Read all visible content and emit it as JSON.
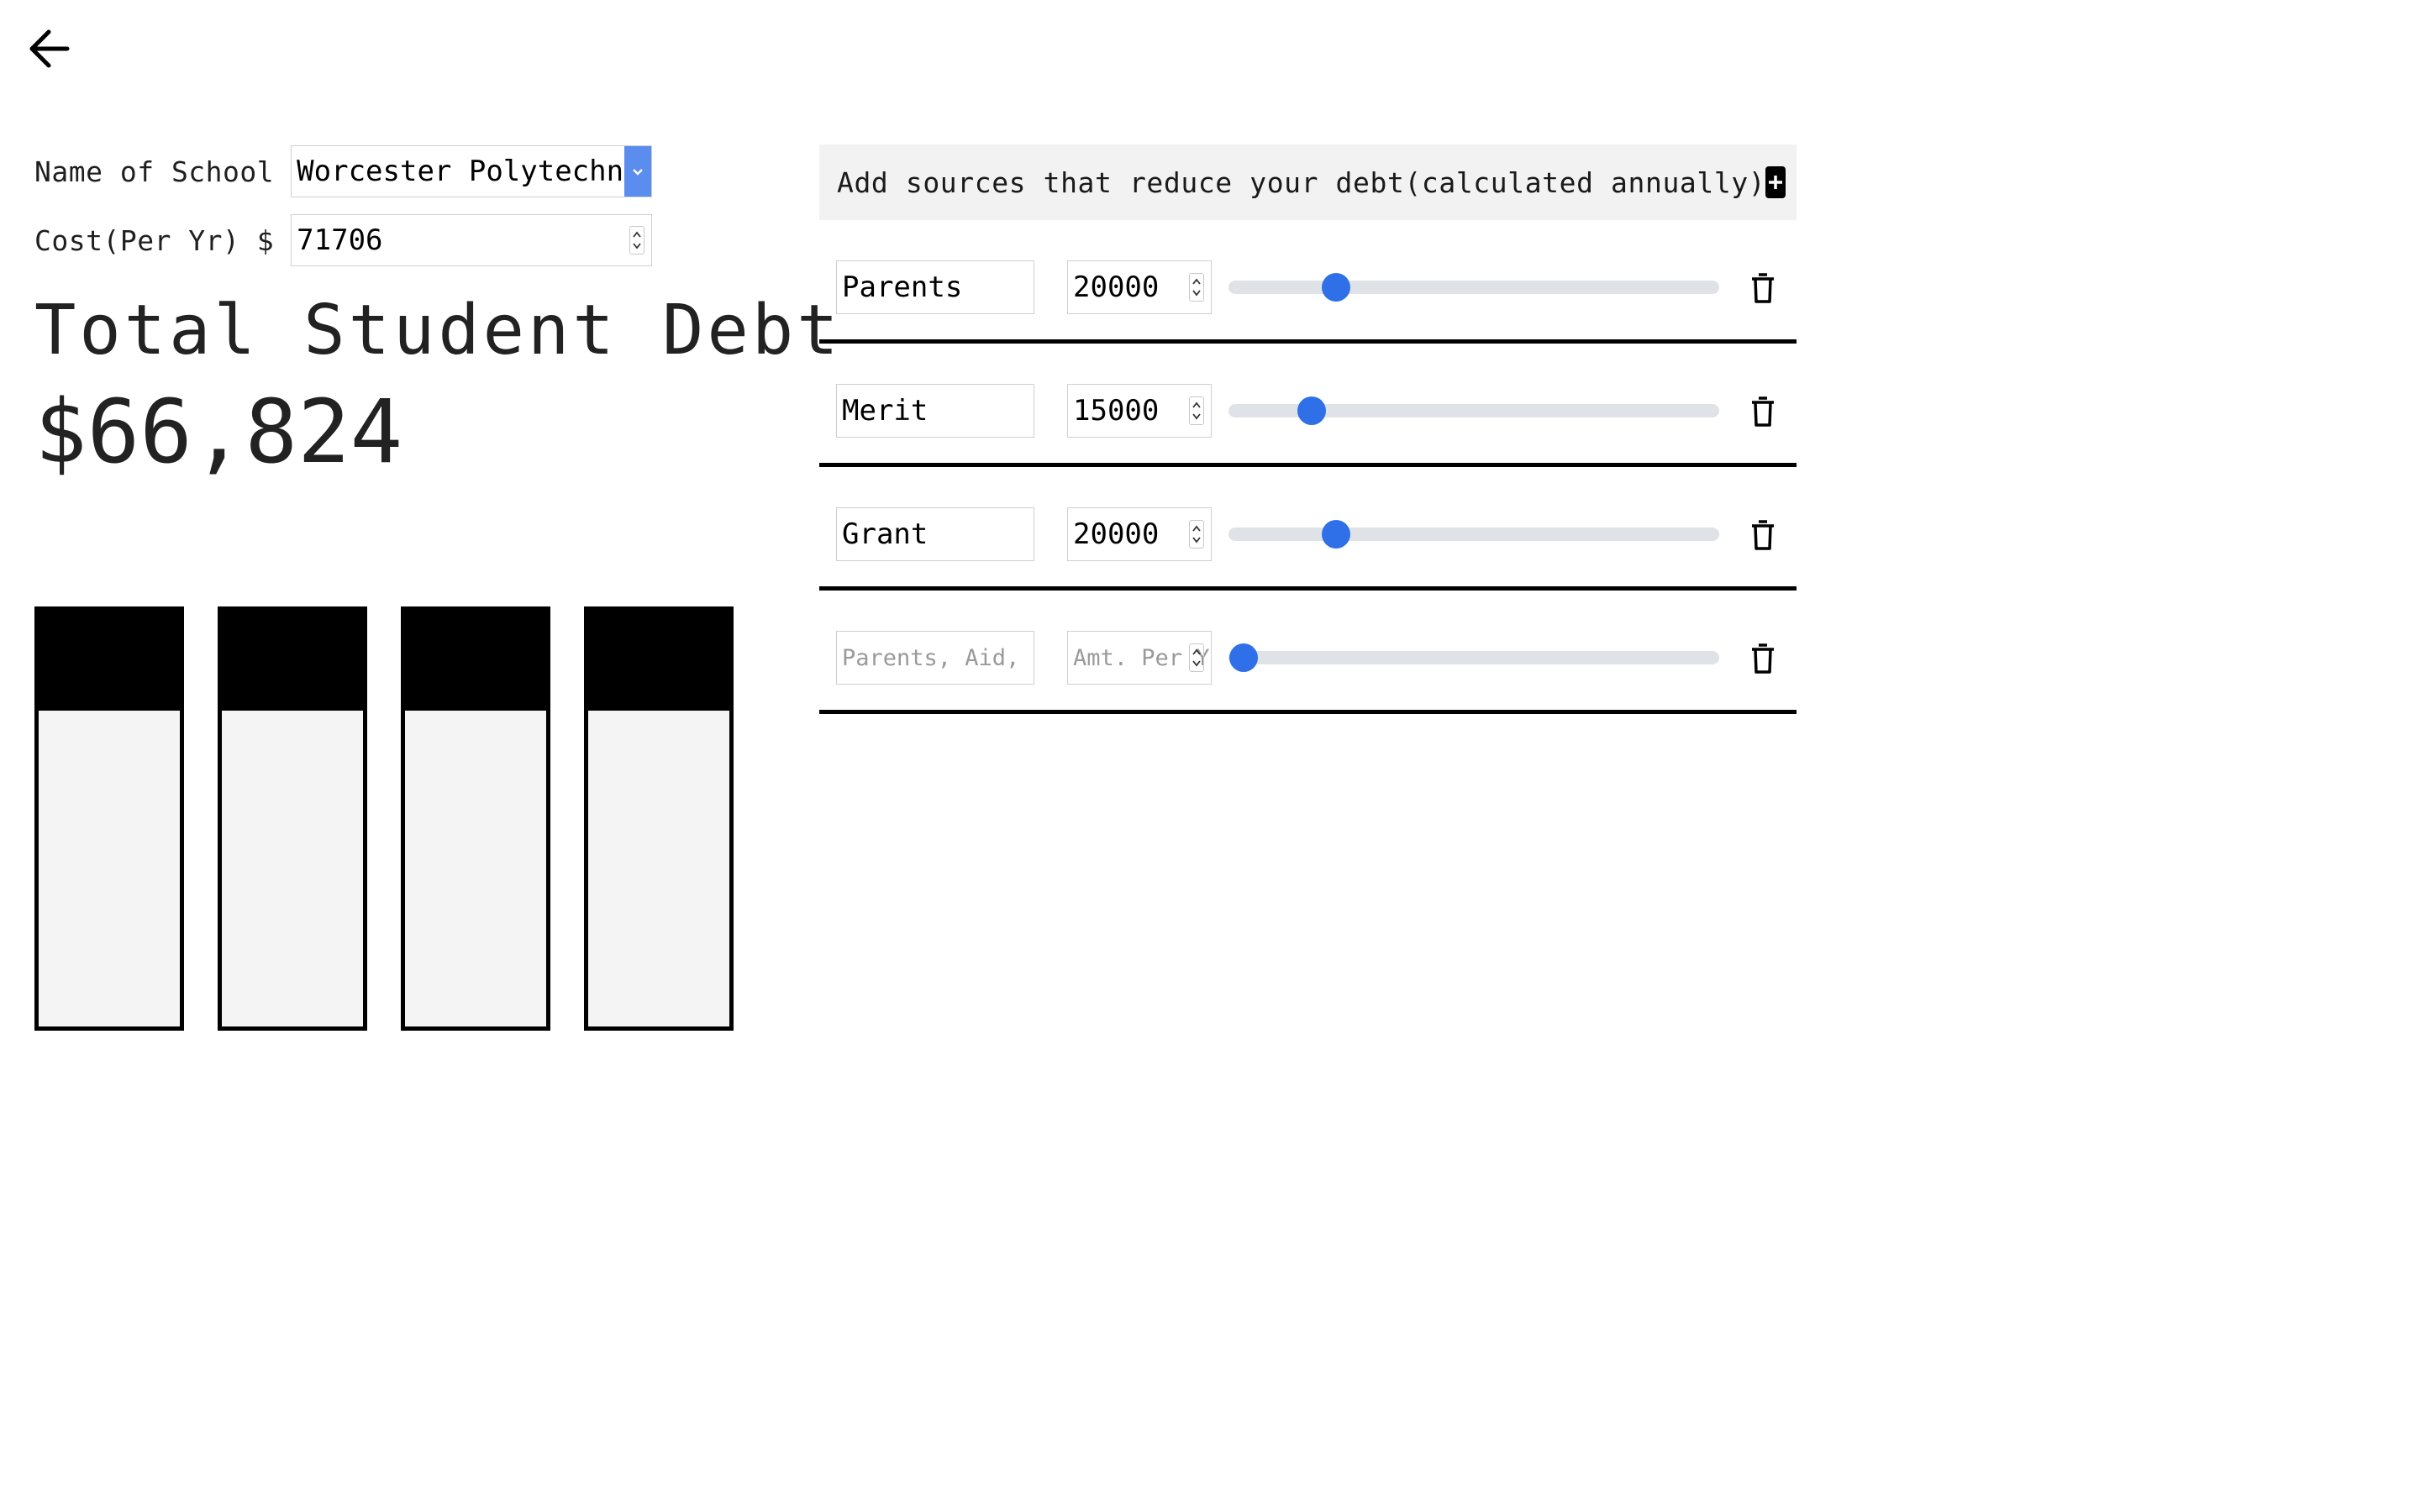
{
  "nav": {
    "back_icon": "arrow-left-icon"
  },
  "school": {
    "name_label": "Name of School",
    "name_value": "Worcester Polytechnic Institute",
    "cost_label": "Cost(Per Yr) $",
    "cost_value": "71706"
  },
  "summary": {
    "title": "Total Student Debt",
    "amount": "$66,824"
  },
  "bars": [
    {
      "fill_fraction": 0.24
    },
    {
      "fill_fraction": 0.24
    },
    {
      "fill_fraction": 0.24
    },
    {
      "fill_fraction": 0.24
    }
  ],
  "sources": {
    "header_text": "Add sources that reduce your debt(calculated annually)",
    "add_icon": "plus-square-icon",
    "rows": [
      {
        "name": "Parents",
        "amount": "20000",
        "slider_fraction": 0.22
      },
      {
        "name": "Merit",
        "amount": "15000",
        "slider_fraction": 0.17
      },
      {
        "name": "Grant",
        "amount": "20000",
        "slider_fraction": 0.22
      },
      {
        "name": "",
        "amount": "",
        "name_placeholder": "Parents, Aid, ...",
        "amount_placeholder": "Amt. Per Yr",
        "slider_fraction": 0.03
      }
    ],
    "delete_icon": "trash-icon"
  },
  "colors": {
    "accent": "#2f6fe8",
    "slider_track": "#dfe2e6",
    "header_bg": "#f2f2f2",
    "bar_bg": "#f4f4f4"
  }
}
